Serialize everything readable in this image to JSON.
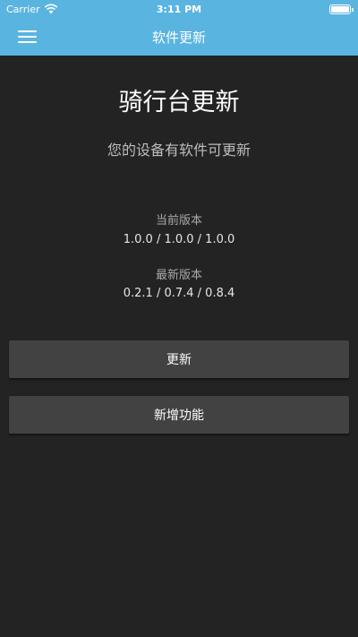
{
  "status_bar": {
    "carrier": "Carrier",
    "time": "3:11 PM",
    "battery_level": 1.0
  },
  "nav": {
    "title": "软件更新",
    "menu_icon": "hamburger-menu-icon",
    "color": "#5ab4e0"
  },
  "main": {
    "title": "骑行台更新",
    "subtitle": "您的设备有软件可更新",
    "current_version_label": "当前版本",
    "current_version_value": "1.0.0 / 1.0.0 / 1.0.0",
    "latest_version_label": "最新版本",
    "latest_version_value": "0.2.1 / 0.7.4 / 0.8.4"
  },
  "buttons": {
    "update_label": "更新",
    "new_features_label": "新增功能"
  },
  "colors": {
    "background": "#232323",
    "button": "#424242",
    "accent": "#5ab4e0"
  }
}
